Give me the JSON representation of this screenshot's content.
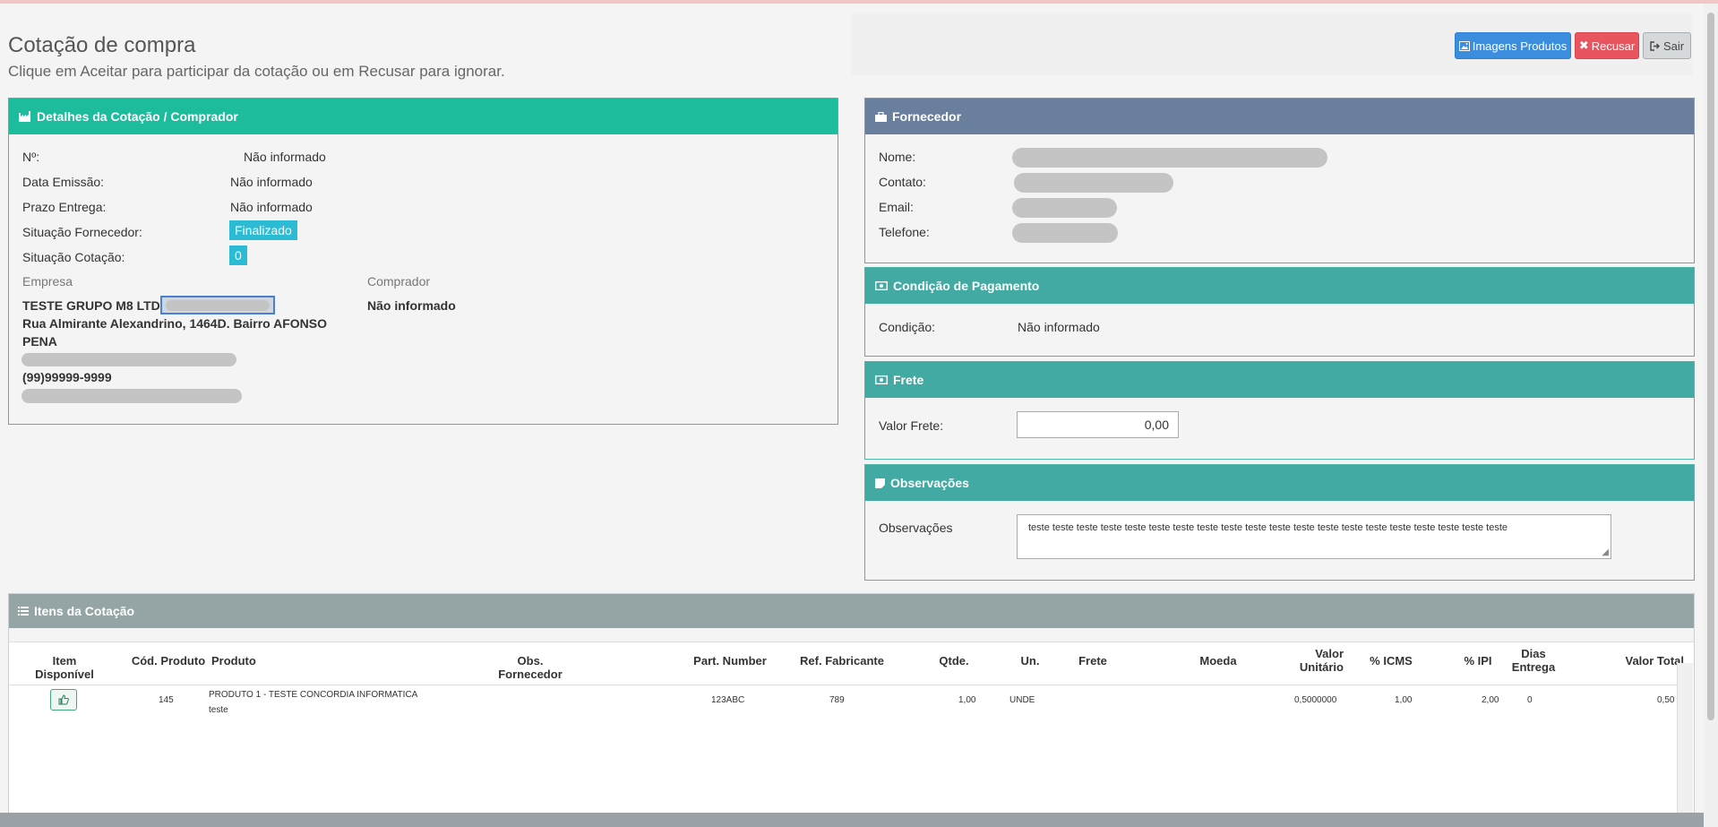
{
  "page": {
    "title": "Cotação de compra",
    "subtitle": "Clique em Aceitar para participar da cotação ou em Recusar para ignorar."
  },
  "buttons": {
    "images": "Imagens Produtos",
    "refuse": "Recusar",
    "exit": "Sair"
  },
  "details": {
    "heading": "Detalhes da Cotação / Comprador",
    "numero_label": "Nº:",
    "numero_value": "Não informado",
    "data_emissao_label": "Data Emissão:",
    "data_emissao_value": "Não informado",
    "prazo_label": "Prazo Entrega:",
    "prazo_value": "Não informado",
    "situacao_fornecedor_label": "Situação Fornecedor:",
    "situacao_fornecedor_value": "Finalizado",
    "situacao_cotacao_label": "Situação Cotação:",
    "situacao_cotacao_value": "0",
    "empresa_label": "Empresa",
    "empresa_name": "TESTE GRUPO M8 LTDA",
    "empresa_address_1": "Rua Almirante Alexandrino, 1464D. Bairro AFONSO",
    "empresa_address_2": "PENA",
    "empresa_phone": "(99)99999-9999",
    "comprador_label": "Comprador",
    "comprador_value": "Não informado"
  },
  "fornecedor": {
    "heading": "Fornecedor",
    "nome_label": "Nome:",
    "contato_label": "Contato:",
    "email_label": "Email:",
    "telefone_label": "Telefone:"
  },
  "pagamento": {
    "heading": "Condição de Pagamento",
    "condicao_label": "Condição:",
    "condicao_value": "Não informado"
  },
  "frete": {
    "heading": "Frete",
    "valor_label": "Valor Frete:",
    "valor_value": "0,00"
  },
  "observacoes": {
    "heading": "Observações",
    "label": "Observações",
    "text": "teste teste teste teste teste teste teste teste teste teste teste teste teste teste teste teste teste teste teste teste"
  },
  "items": {
    "heading": "Itens da Cotação",
    "columns": {
      "item_disponivel": "Item Disponível",
      "cod_produto": "Cód. Produto",
      "produto": "Produto",
      "obs_fornecedor": "Obs. Fornecedor",
      "part_number": "Part. Number",
      "ref_fabricante": "Ref. Fabricante",
      "qtde": "Qtde.",
      "un": "Un.",
      "frete": "Frete",
      "moeda": "Moeda",
      "valor_unitario_1": "Valor",
      "valor_unitario_2": "Unitário",
      "icms": "% ICMS",
      "ipi": "% IPI",
      "dias_entrega_1": "Dias",
      "dias_entrega_2": "Entrega",
      "valor_total": "Valor Total"
    },
    "rows": [
      {
        "cod_produto": "145",
        "produto": "PRODUTO 1 - TESTE CONCORDIA INFORMATICA",
        "produto_desc": "teste",
        "part_number": "123ABC",
        "ref_fabricante": "789",
        "qtde": "1,00",
        "un": "UNDE",
        "valor_unitario": "0,5000000",
        "icms": "1,00",
        "ipi": "2,00",
        "dias_entrega": "0",
        "valor_total": "0,50"
      }
    ]
  },
  "colors": {
    "details_header": "#1cbc9c",
    "fornecedor_header": "#6a7f9e",
    "teal_header": "#42aaa2",
    "items_header": "#95a5a6",
    "btn_primary": "#3c8dde",
    "btn_danger": "#e8555e"
  }
}
